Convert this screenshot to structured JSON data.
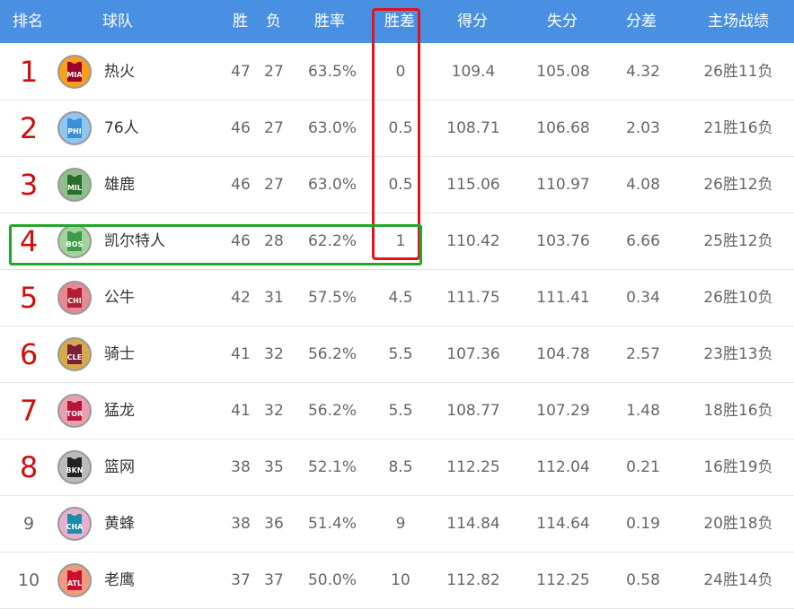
{
  "header": {
    "rank": "排名",
    "team": "球队",
    "win": "胜",
    "loss": "负",
    "pct": "胜率",
    "gb": "胜差",
    "pts": "得分",
    "opp": "失分",
    "diff": "分差",
    "home": "主场战绩"
  },
  "rows": [
    {
      "rank": "1",
      "abbr": "MIA",
      "team": "热火",
      "w": "47",
      "l": "27",
      "pct": "63.5%",
      "gb": "0",
      "pts": "109.4",
      "opp": "105.08",
      "diff": "4.32",
      "home": "26胜11负",
      "color": "#98002e",
      "ring": "#f9a01b"
    },
    {
      "rank": "2",
      "abbr": "PHI",
      "team": "76人",
      "w": "46",
      "l": "27",
      "pct": "63.0%",
      "gb": "0.5",
      "pts": "108.71",
      "opp": "106.68",
      "diff": "2.03",
      "home": "21胜16负",
      "color": "#3b8fd9",
      "ring": "#8ec7f0"
    },
    {
      "rank": "3",
      "abbr": "MIL",
      "team": "雄鹿",
      "w": "46",
      "l": "27",
      "pct": "63.0%",
      "gb": "0.5",
      "pts": "115.06",
      "opp": "110.97",
      "diff": "4.08",
      "home": "26胜12负",
      "color": "#2a6e2c",
      "ring": "#8fbf8c"
    },
    {
      "rank": "4",
      "abbr": "BOS",
      "team": "凯尔特人",
      "w": "46",
      "l": "28",
      "pct": "62.2%",
      "gb": "1",
      "pts": "110.42",
      "opp": "103.76",
      "diff": "6.66",
      "home": "25胜12负",
      "color": "#3e9a4a",
      "ring": "#a3d39c"
    },
    {
      "rank": "5",
      "abbr": "CHI",
      "team": "公牛",
      "w": "42",
      "l": "31",
      "pct": "57.5%",
      "gb": "4.5",
      "pts": "111.75",
      "opp": "111.41",
      "diff": "0.34",
      "home": "26胜10负",
      "color": "#b01f35",
      "ring": "#e58a93"
    },
    {
      "rank": "6",
      "abbr": "CLE",
      "team": "骑士",
      "w": "41",
      "l": "32",
      "pct": "56.2%",
      "gb": "5.5",
      "pts": "107.36",
      "opp": "104.78",
      "diff": "2.57",
      "home": "23胜13负",
      "color": "#7a1f3a",
      "ring": "#d7a94a"
    },
    {
      "rank": "7",
      "abbr": "TOR",
      "team": "猛龙",
      "w": "41",
      "l": "32",
      "pct": "56.2%",
      "gb": "5.5",
      "pts": "108.77",
      "opp": "107.29",
      "diff": "1.48",
      "home": "18胜16负",
      "color": "#b8133a",
      "ring": "#e9a0ae"
    },
    {
      "rank": "8",
      "abbr": "BKN",
      "team": "篮网",
      "w": "38",
      "l": "35",
      "pct": "52.1%",
      "gb": "8.5",
      "pts": "112.25",
      "opp": "112.04",
      "diff": "0.21",
      "home": "16胜19负",
      "color": "#222222",
      "ring": "#bbbbbb"
    },
    {
      "rank": "9",
      "abbr": "CHA",
      "team": "黄蜂",
      "w": "38",
      "l": "36",
      "pct": "51.4%",
      "gb": "9",
      "pts": "114.84",
      "opp": "114.64",
      "diff": "0.19",
      "home": "20胜18负",
      "color": "#1d8ca8",
      "ring": "#e8b0d0"
    },
    {
      "rank": "10",
      "abbr": "ATL",
      "team": "老鹰",
      "w": "37",
      "l": "37",
      "pct": "50.0%",
      "gb": "10",
      "pts": "112.82",
      "opp": "112.25",
      "diff": "0.58",
      "home": "24胜14负",
      "color": "#c8102e",
      "ring": "#f19a7e"
    }
  ],
  "highlight_colors": {
    "gb_column": "#e8111a",
    "row_4": "#22a72c"
  }
}
